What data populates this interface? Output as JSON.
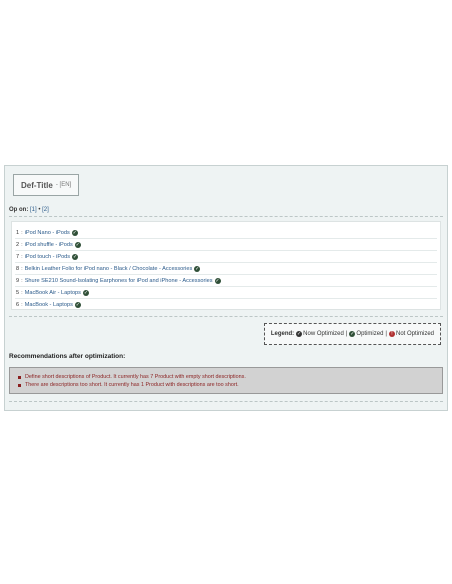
{
  "title": {
    "main": "Def-Title",
    "lang": "- [EN]"
  },
  "op_on": {
    "label": "Op on:",
    "pages": "[1]",
    "divider": "•",
    "pages2": "[2]"
  },
  "products": [
    {
      "num": "1",
      "name": "iPod Nano - iPods"
    },
    {
      "num": "2",
      "name": "iPod shuffle - iPods"
    },
    {
      "num": "7",
      "name": "iPod touch - iPods"
    },
    {
      "num": "8",
      "name": "Belkin Leather Folio for iPod nano - Black / Chocolate - Accessories"
    },
    {
      "num": "9",
      "name": "Shure SE210 Sound-Isolating Earphones for iPod and iPhone - Accessories"
    },
    {
      "num": "5",
      "name": "MacBook Air - Laptops"
    },
    {
      "num": "6",
      "name": "MacBook - Laptops"
    }
  ],
  "legend": {
    "label": "Legend:",
    "now_optimized": "Now Optimized",
    "optimized": "Optimized",
    "not_optimized": "Not Optimized",
    "separator": "|",
    "colors": {
      "now": "#333333",
      "optimized": "#2f4f37",
      "not": "#b03030"
    }
  },
  "recommendations": {
    "title": "Recommendations after optimization:",
    "items": [
      "Define short descriptions of Product. It currently has 7 Product with empty short descriptions.",
      "There are descriptions too short. It currently has 1 Product with descriptions are too short."
    ]
  }
}
